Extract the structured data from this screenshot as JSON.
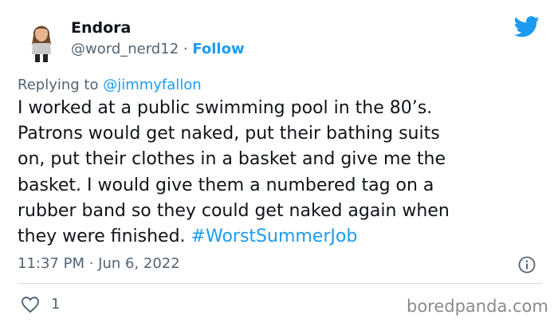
{
  "tweet": {
    "author": {
      "display_name": "Endora",
      "handle": "@word_nerd12",
      "separator": " · ",
      "follow_label": "Follow"
    },
    "replying": {
      "prefix": "Replying to ",
      "mention": "@jimmyfallon"
    },
    "body_lines": [
      "I worked at a public swimming pool in the 80’s.",
      "Patrons would get naked, put their bathing suits",
      "on, put their clothes in a basket and give me the",
      "basket. I would give them a numbered tag on a",
      "rubber band so they could get naked again when",
      "they were finished. "
    ],
    "hashtag": "#WorstSummerJob",
    "timestamp": "11:37 PM · Jun 6, 2022",
    "like_count": "1"
  },
  "watermark": "boredpanda.com",
  "icons": {
    "avatar": "bitmoji-avatar",
    "brand": "twitter-bird-icon",
    "info": "info-icon",
    "like": "heart-icon"
  },
  "colors": {
    "accent": "#1d9bf0",
    "text": "#0f1419",
    "secondary": "#536471",
    "divider": "#cfd9de"
  }
}
